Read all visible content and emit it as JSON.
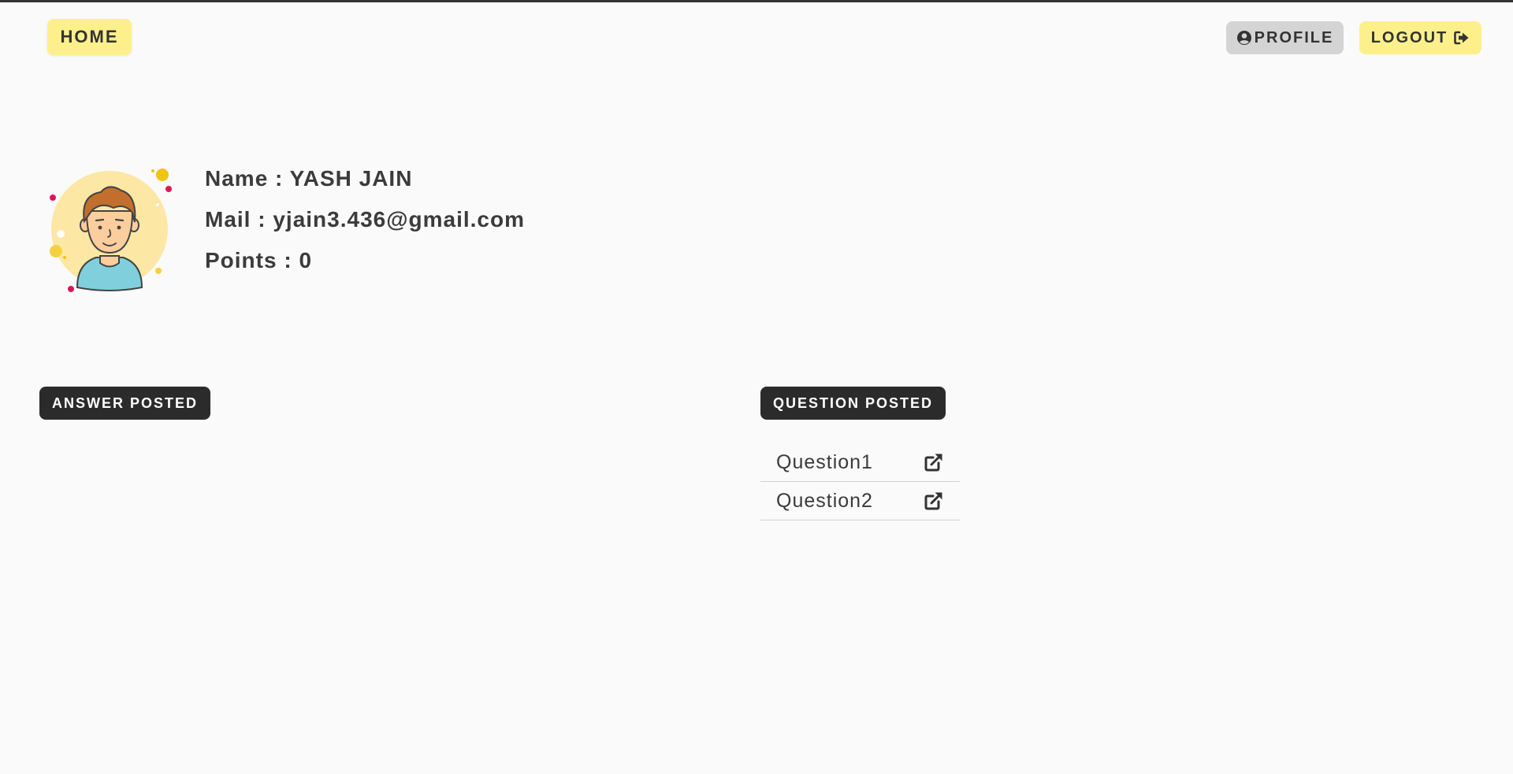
{
  "nav": {
    "home_label": "HOME",
    "profile_label": "PROFILE",
    "logout_label": "LOGOUT",
    "profile_icon": "user-circle-icon",
    "logout_icon": "sign-out-icon"
  },
  "profile": {
    "avatar_icon": "user-avatar-illustration",
    "name_line": "Name : YASH JAIN",
    "mail_line": "Mail : yjain3.436@gmail.com",
    "points_line": "Points : 0"
  },
  "sections": {
    "answers_title": "ANSWER POSTED",
    "questions_title": "QUESTION POSTED"
  },
  "questions": [
    {
      "title": "Question1",
      "icon": "external-link-icon"
    },
    {
      "title": "Question2",
      "icon": "external-link-icon"
    }
  ],
  "colors": {
    "accent_yellow": "#fdf08b",
    "profile_gray": "#d4d4d4",
    "badge_dark": "#2b2b2b",
    "background": "#fafafa"
  }
}
